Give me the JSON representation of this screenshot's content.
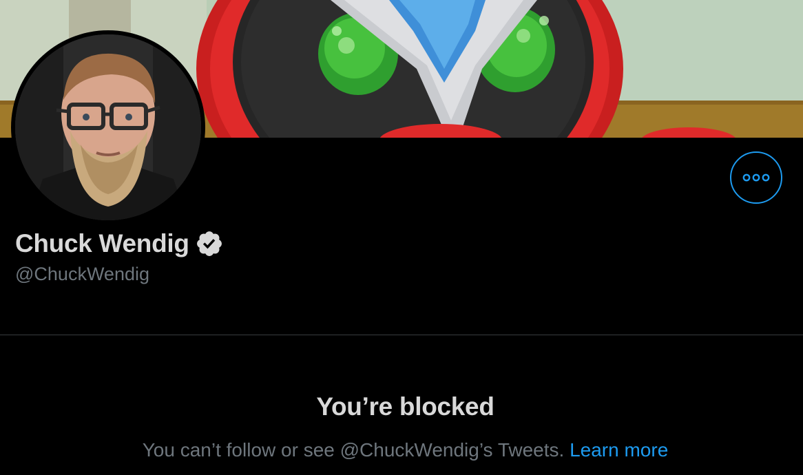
{
  "profile": {
    "display_name": "Chuck Wendig",
    "handle": "@ChuckWendig",
    "verified_icon": "verified-badge-icon",
    "more_icon": "more-options-icon"
  },
  "blocked": {
    "title": "You’re blocked",
    "message": "You can’t follow or see @ChuckWendig’s Tweets.",
    "learn_more": "Learn more"
  },
  "colors": {
    "background": "#000000",
    "accent": "#1d9bf0",
    "primary_text": "#d9d9d9",
    "secondary_text": "#6e767d",
    "divider": "#3a3d40"
  }
}
